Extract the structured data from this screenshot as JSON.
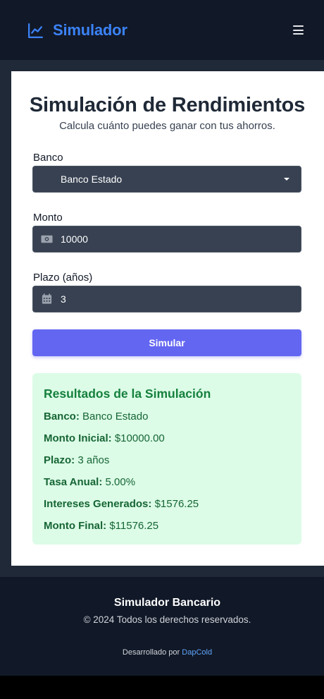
{
  "navbar": {
    "brand": "Simulador",
    "brand_icon": "chart-line-icon",
    "menu_icon": "hamburger-icon",
    "brand_color": "#3b82f6"
  },
  "form": {
    "title": "Simulación de Rendimientos",
    "subtitle": "Calcula cuánto puedes ganar con tus ahorros.",
    "bank_label": "Banco",
    "bank_value": "Banco Estado",
    "amount_label": "Monto",
    "amount_value": "10000",
    "amount_icon": "money-bill-icon",
    "term_label": "Plazo (años)",
    "term_value": "3",
    "term_icon": "calendar-icon",
    "submit_label": "Simular",
    "submit_color": "#6366f1"
  },
  "results": {
    "title": "Resultados de la Simulación",
    "rows": [
      {
        "label": "Banco:",
        "value": "Banco Estado"
      },
      {
        "label": "Monto Inicial:",
        "value": "$10000.00"
      },
      {
        "label": "Plazo:",
        "value": "3 años"
      },
      {
        "label": "Tasa Anual:",
        "value": "5.00%"
      },
      {
        "label": "Intereses Generados:",
        "value": "$1576.25"
      },
      {
        "label": "Monto Final:",
        "value": "$11576.25"
      }
    ],
    "background": "#dcfce7",
    "accent": "#15803d"
  },
  "footer": {
    "title": "Simulador Bancario",
    "copyright": "© 2024 Todos los derechos reservados.",
    "dev_prefix": "Desarrollado por",
    "dev_link": "DapCold"
  }
}
